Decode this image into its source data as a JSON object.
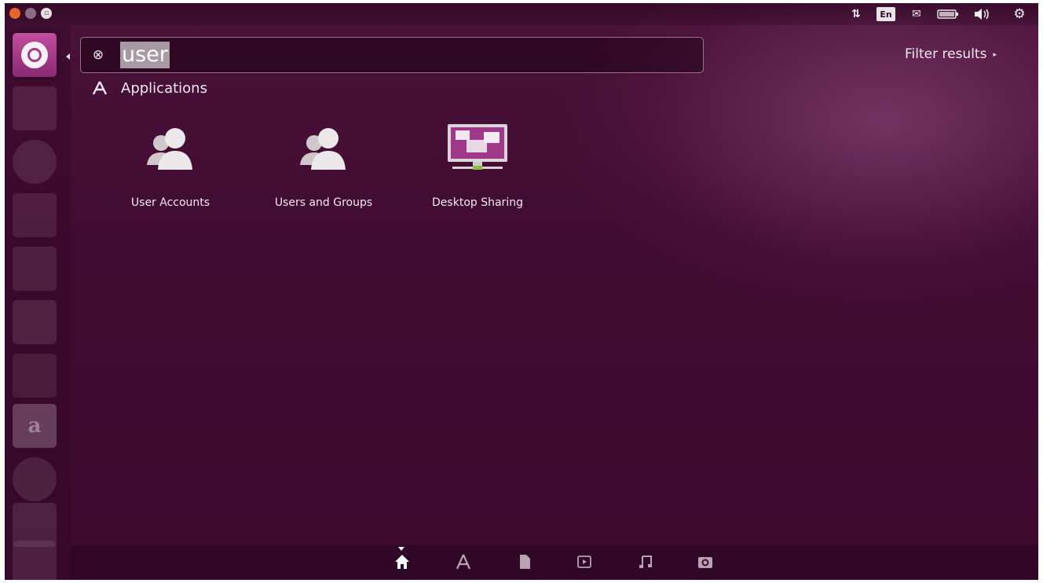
{
  "window": {
    "buttons": [
      "close",
      "minimize",
      "maximize"
    ]
  },
  "top_panel": {
    "indicators": [
      {
        "name": "network-icon",
        "glyph": "⇅"
      },
      {
        "name": "keyboard-layout",
        "text": "En"
      },
      {
        "name": "mail-icon",
        "glyph": "✉"
      },
      {
        "name": "battery-icon",
        "glyph": "▭"
      },
      {
        "name": "volume-icon",
        "glyph": "◂))"
      },
      {
        "name": "settings-gear-icon",
        "glyph": "⚙"
      }
    ],
    "keyboard_layout": "En"
  },
  "launcher": {
    "items": [
      "dash-home-icon",
      "files-icon",
      "firefox-icon",
      "writer-icon",
      "calc-icon",
      "impress-icon",
      "software-center-icon",
      "amazon-icon",
      "system-settings-icon",
      "ubuntu-one-icon",
      "trash-icon"
    ],
    "amazon_glyph": "a"
  },
  "search": {
    "query": "user",
    "clear_glyph": "⊗"
  },
  "filter": {
    "label": "Filter results",
    "arrow": "▸"
  },
  "results": {
    "category_title": "Applications",
    "apps": [
      {
        "label": "User Accounts",
        "icon": "users-icon"
      },
      {
        "label": "Users and Groups",
        "icon": "users-icon"
      },
      {
        "label": "Desktop Sharing",
        "icon": "desktop-sharing-icon"
      }
    ]
  },
  "lenses": [
    {
      "name": "home-lens",
      "glyph": "⌂",
      "active": true
    },
    {
      "name": "applications-lens",
      "glyph": "A"
    },
    {
      "name": "files-lens",
      "glyph": "▮"
    },
    {
      "name": "video-lens",
      "glyph": "▣"
    },
    {
      "name": "music-lens",
      "glyph": "♫"
    },
    {
      "name": "photo-lens",
      "glyph": "◎"
    }
  ],
  "colors": {
    "background": "#3c0a2e",
    "accent": "#a83b86",
    "close": "#e9632f"
  }
}
